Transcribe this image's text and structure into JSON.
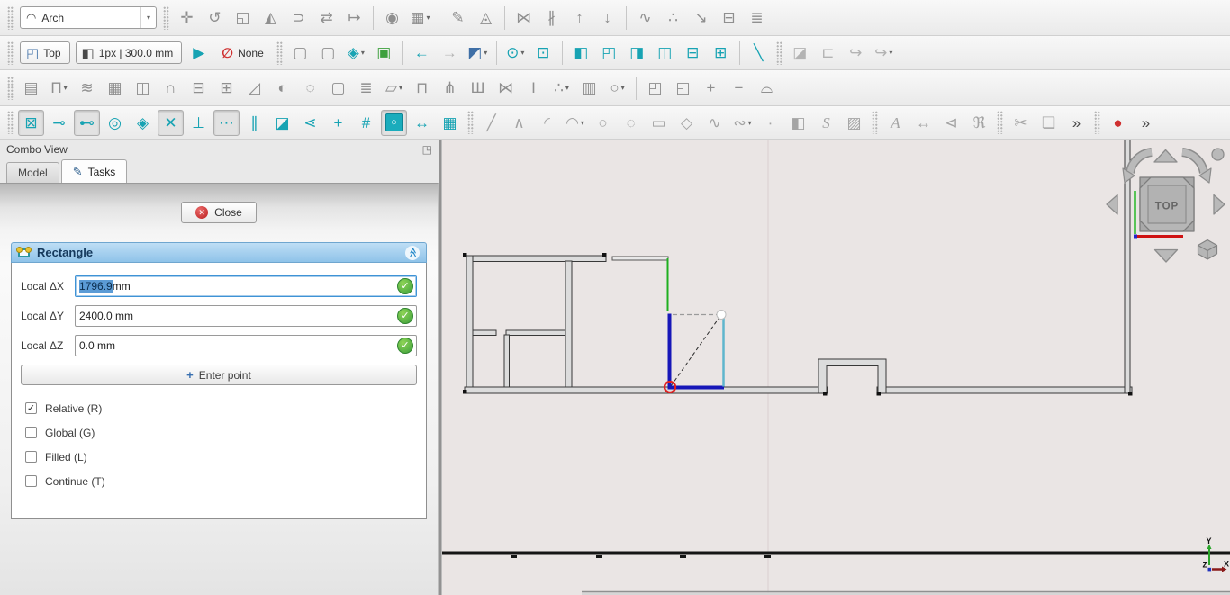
{
  "toolbars": {
    "row1": [
      {
        "t": "grip"
      },
      {
        "t": "select",
        "name": "workbench-selector",
        "icon": "arch-workbench-icon",
        "glyph": "◠",
        "c": "dark",
        "label": "Arch",
        "dd": true
      },
      {
        "t": "grip"
      },
      {
        "t": "btn",
        "name": "draft-move",
        "icon": "move-icon",
        "glyph": "✛",
        "c": "gray"
      },
      {
        "t": "btn",
        "name": "draft-rotate",
        "icon": "rotate-icon",
        "glyph": "↺",
        "c": "gray"
      },
      {
        "t": "btn",
        "name": "draft-scale",
        "icon": "scale-icon",
        "glyph": "◱",
        "c": "gray"
      },
      {
        "t": "btn",
        "name": "draft-mirror",
        "icon": "mirror-icon",
        "glyph": "◭",
        "c": "gray"
      },
      {
        "t": "btn",
        "name": "draft-offset",
        "icon": "offset-icon",
        "glyph": "⊃",
        "c": "gray"
      },
      {
        "t": "btn",
        "name": "draft-trimex",
        "icon": "trimex-icon",
        "glyph": "⇄",
        "c": "gray"
      },
      {
        "t": "btn",
        "name": "draft-stretch",
        "icon": "stretch-icon",
        "glyph": "↦",
        "c": "gray"
      },
      {
        "t": "sep"
      },
      {
        "t": "btn",
        "name": "draft-clone",
        "icon": "clone-icon",
        "glyph": "◉",
        "c": "gray"
      },
      {
        "t": "btn",
        "name": "draft-array-tools",
        "icon": "array-icon",
        "glyph": "▦",
        "c": "gray",
        "dd": true
      },
      {
        "t": "sep"
      },
      {
        "t": "btn",
        "name": "draft-edit",
        "icon": "edit-pencil-icon",
        "glyph": "✎",
        "c": "gray"
      },
      {
        "t": "btn",
        "name": "draft-highlight-subelements",
        "icon": "subelement-icon",
        "glyph": "◬",
        "c": "gray"
      },
      {
        "t": "sep"
      },
      {
        "t": "btn",
        "name": "draft-join",
        "icon": "join-icon",
        "glyph": "⋈",
        "c": "gray"
      },
      {
        "t": "btn",
        "name": "draft-split",
        "icon": "split-icon",
        "glyph": "∦",
        "c": "gray"
      },
      {
        "t": "btn",
        "name": "draft-upgrade",
        "icon": "upgrade-arrow-icon",
        "glyph": "↑",
        "c": "gray"
      },
      {
        "t": "btn",
        "name": "draft-downgrade",
        "icon": "downgrade-arrow-icon",
        "glyph": "↓",
        "c": "gray"
      },
      {
        "t": "sep"
      },
      {
        "t": "btn",
        "name": "draft-wire-to-bspline",
        "icon": "wire-bspline-icon",
        "glyph": "∿",
        "c": "gray"
      },
      {
        "t": "btn",
        "name": "draft-add-point",
        "icon": "add-point-icon",
        "glyph": "∴",
        "c": "gray"
      },
      {
        "t": "btn",
        "name": "draft-to-sketch",
        "icon": "draft-sketch-icon",
        "glyph": "↘",
        "c": "gray"
      },
      {
        "t": "btn",
        "name": "draft-shape-2d-view",
        "icon": "shape-2d-icon",
        "glyph": "⊟",
        "c": "gray"
      },
      {
        "t": "btn",
        "name": "draft-layer",
        "icon": "layers-icon",
        "glyph": "≣",
        "c": "gray"
      }
    ],
    "row2": [
      {
        "t": "grip"
      },
      {
        "t": "labelbtn",
        "name": "view-current-button",
        "icon": "view-cube-icon",
        "glyph": "◰",
        "c": "blue",
        "label": "Top"
      },
      {
        "t": "labelbtn",
        "name": "line-style-button",
        "icon": "line-style-icon",
        "glyph": "◧",
        "c": "dark",
        "label": "1px | 300.0 mm"
      },
      {
        "t": "btn",
        "name": "apply-current-style",
        "icon": "apply-style-arrow-icon",
        "glyph": "▶",
        "c": "teal"
      },
      {
        "t": "flat",
        "name": "autogroup-button",
        "icon": "no-autogroup-icon",
        "glyph": "∅",
        "c": "red",
        "label": "None"
      },
      {
        "t": "grip"
      },
      {
        "t": "btn",
        "name": "box-selection",
        "icon": "box-select-icon",
        "glyph": "▢",
        "c": "gray"
      },
      {
        "t": "btn",
        "name": "box-element-selection",
        "icon": "box-element-select-icon",
        "glyph": "▢",
        "c": "gray"
      },
      {
        "t": "btn",
        "name": "toggle-construction-mode",
        "icon": "construction-mode-icon",
        "glyph": "◈",
        "c": "teal",
        "dd": true
      },
      {
        "t": "btn",
        "name": "select-visible-object",
        "icon": "select-view-cube-icon",
        "glyph": "▣",
        "c": "green"
      },
      {
        "t": "sep"
      },
      {
        "t": "btn",
        "name": "nav-back",
        "icon": "back-arrow-icon",
        "glyph": "←",
        "c": "teal"
      },
      {
        "t": "btn",
        "name": "nav-forward",
        "icon": "forward-arrow-icon",
        "glyph": "→",
        "c": "silver"
      },
      {
        "t": "btn",
        "name": "view-axonometric",
        "icon": "axonometric-cube-icon",
        "glyph": "◩",
        "c": "blue",
        "dd": true
      },
      {
        "t": "sep"
      },
      {
        "t": "btn",
        "name": "zoom-tools",
        "icon": "magnifier-icon",
        "glyph": "⊙",
        "c": "teal",
        "dd": true
      },
      {
        "t": "btn",
        "name": "view-fit-all",
        "icon": "fit-all-cube-icon",
        "glyph": "⊡",
        "c": "teal"
      },
      {
        "t": "sep"
      },
      {
        "t": "btn",
        "name": "view-front",
        "icon": "front-view-cube-icon",
        "glyph": "◧",
        "c": "teal"
      },
      {
        "t": "btn",
        "name": "view-top",
        "icon": "top-view-cube-icon",
        "glyph": "◰",
        "c": "teal"
      },
      {
        "t": "btn",
        "name": "view-right",
        "icon": "right-view-cube-icon",
        "glyph": "◨",
        "c": "teal"
      },
      {
        "t": "btn",
        "name": "view-rear",
        "icon": "rear-view-cube-icon",
        "glyph": "◫",
        "c": "teal"
      },
      {
        "t": "btn",
        "name": "view-bottom",
        "icon": "bottom-view-cube-icon",
        "glyph": "⊟",
        "c": "teal"
      },
      {
        "t": "btn",
        "name": "view-left",
        "icon": "left-view-cube-icon",
        "glyph": "⊞",
        "c": "teal"
      },
      {
        "t": "sep"
      },
      {
        "t": "btn",
        "name": "measure-distance",
        "icon": "ruler-icon",
        "glyph": "╲",
        "c": "teal"
      },
      {
        "t": "grip"
      },
      {
        "t": "btn",
        "name": "part-simple-copy",
        "icon": "part-solid-icon",
        "glyph": "◪",
        "c": "silver"
      },
      {
        "t": "btn",
        "name": "std-open",
        "icon": "folder-icon",
        "glyph": "⊏",
        "c": "silver"
      },
      {
        "t": "btn",
        "name": "std-export",
        "icon": "export-icon",
        "glyph": "↪",
        "c": "silver"
      },
      {
        "t": "btn",
        "name": "std-export-more",
        "icon": "export-more-icon",
        "glyph": "↪",
        "c": "silver",
        "dd": true
      }
    ],
    "row3": [
      {
        "t": "grip"
      },
      {
        "t": "btn",
        "name": "arch-wall",
        "icon": "wall-icon",
        "glyph": "▤",
        "c": "gray"
      },
      {
        "t": "btn",
        "name": "arch-structure",
        "icon": "structure-icon",
        "glyph": "Π",
        "c": "gray",
        "dd": true
      },
      {
        "t": "btn",
        "name": "arch-rebar",
        "icon": "rebar-icon",
        "glyph": "≋",
        "c": "gray"
      },
      {
        "t": "btn",
        "name": "arch-curtain-wall",
        "icon": "curtain-wall-icon",
        "glyph": "▦",
        "c": "gray"
      },
      {
        "t": "btn",
        "name": "arch-building-part",
        "icon": "building-part-icon",
        "glyph": "◫",
        "c": "gray"
      },
      {
        "t": "btn",
        "name": "arch-project",
        "icon": "dome-icon",
        "glyph": "∩",
        "c": "gray"
      },
      {
        "t": "btn",
        "name": "arch-reference",
        "icon": "reference-icon",
        "glyph": "⊟",
        "c": "gray"
      },
      {
        "t": "btn",
        "name": "arch-window",
        "icon": "window-icon",
        "glyph": "⊞",
        "c": "gray"
      },
      {
        "t": "btn",
        "name": "arch-roof",
        "icon": "roof-icon",
        "glyph": "◿",
        "c": "gray"
      },
      {
        "t": "btn",
        "name": "arch-axis",
        "icon": "axis-icon",
        "glyph": "◐",
        "c": "gray"
      },
      {
        "t": "btn",
        "name": "arch-section-plane",
        "icon": "section-plane-icon",
        "glyph": "◌",
        "c": "gray"
      },
      {
        "t": "btn",
        "name": "arch-space",
        "icon": "space-icon",
        "glyph": "▢",
        "c": "gray"
      },
      {
        "t": "btn",
        "name": "arch-stairs",
        "icon": "stairs-icon",
        "glyph": "≣",
        "c": "gray"
      },
      {
        "t": "btn",
        "name": "arch-panel",
        "icon": "panel-icon",
        "glyph": "▱",
        "c": "gray",
        "dd": true
      },
      {
        "t": "btn",
        "name": "arch-equipment",
        "icon": "equipment-icon",
        "glyph": "⊓",
        "c": "gray"
      },
      {
        "t": "btn",
        "name": "arch-frame",
        "icon": "frame-icon",
        "glyph": "⋔",
        "c": "gray"
      },
      {
        "t": "btn",
        "name": "arch-fence",
        "icon": "fence-icon",
        "glyph": "Ш",
        "c": "gray"
      },
      {
        "t": "btn",
        "name": "arch-truss",
        "icon": "truss-icon",
        "glyph": "⋈",
        "c": "gray"
      },
      {
        "t": "btn",
        "name": "arch-profile",
        "icon": "profile-ibeam-icon",
        "glyph": "I",
        "c": "gray"
      },
      {
        "t": "btn",
        "name": "arch-material",
        "icon": "material-balls-icon",
        "glyph": "∴",
        "c": "gray",
        "dd": true
      },
      {
        "t": "btn",
        "name": "arch-schedule",
        "icon": "schedule-table-icon",
        "glyph": "▥",
        "c": "gray"
      },
      {
        "t": "btn",
        "name": "arch-pipe",
        "icon": "pipe-icon",
        "glyph": "○",
        "c": "gray",
        "dd": true
      },
      {
        "t": "sep"
      },
      {
        "t": "btn",
        "name": "arch-cut-plane",
        "icon": "cut-plane-icon",
        "glyph": "◰",
        "c": "gray"
      },
      {
        "t": "btn",
        "name": "arch-cut-line",
        "icon": "cut-line-icon",
        "glyph": "◱",
        "c": "gray"
      },
      {
        "t": "btn",
        "name": "arch-add-component",
        "icon": "plus-icon",
        "glyph": "+",
        "c": "gray"
      },
      {
        "t": "btn",
        "name": "arch-remove-component",
        "icon": "minus-icon",
        "glyph": "−",
        "c": "gray"
      },
      {
        "t": "btn",
        "name": "arch-survey",
        "icon": "helmet-icon",
        "glyph": "⌓",
        "c": "gray"
      }
    ],
    "row4": [
      {
        "t": "grip"
      },
      {
        "t": "btn",
        "name": "snap-lock",
        "icon": "padlock-icon",
        "glyph": "⊠",
        "c": "teal",
        "pressed": true
      },
      {
        "t": "btn",
        "name": "snap-endpoint",
        "icon": "endpoint-icon",
        "glyph": "⊸",
        "c": "teal"
      },
      {
        "t": "btn",
        "name": "snap-midpoint",
        "icon": "midpoint-icon",
        "glyph": "⊷",
        "c": "teal",
        "pressed": true
      },
      {
        "t": "btn",
        "name": "snap-center",
        "icon": "center-icon",
        "glyph": "◎",
        "c": "teal"
      },
      {
        "t": "btn",
        "name": "snap-angle",
        "icon": "angle-icon",
        "glyph": "◈",
        "c": "teal"
      },
      {
        "t": "btn",
        "name": "snap-intersection",
        "icon": "intersection-icon",
        "glyph": "✕",
        "c": "teal",
        "pressed": true
      },
      {
        "t": "btn",
        "name": "snap-perpendicular",
        "icon": "perpendicular-icon",
        "glyph": "⊥",
        "c": "teal"
      },
      {
        "t": "btn",
        "name": "snap-extension",
        "icon": "extension-dots-icon",
        "glyph": "⋯",
        "c": "teal",
        "pressed": true
      },
      {
        "t": "btn",
        "name": "snap-parallel",
        "icon": "parallel-icon",
        "glyph": "∥",
        "c": "teal"
      },
      {
        "t": "btn",
        "name": "snap-ortho",
        "icon": "ortho-icon",
        "glyph": "◪",
        "c": "teal"
      },
      {
        "t": "btn",
        "name": "snap-near",
        "icon": "near-icon",
        "glyph": "⋖",
        "c": "teal"
      },
      {
        "t": "btn",
        "name": "snap-special",
        "icon": "special-plus-icon",
        "glyph": "+",
        "c": "teal"
      },
      {
        "t": "btn",
        "name": "snap-grid",
        "icon": "grid-hash-icon",
        "glyph": "#",
        "c": "teal"
      },
      {
        "t": "btn",
        "name": "snap-working-plane",
        "icon": "working-plane-icon",
        "glyph": "○",
        "c": "teal",
        "pressed": true,
        "wp": true
      },
      {
        "t": "btn",
        "name": "snap-dimensions",
        "icon": "dimensions-icon",
        "glyph": "↔",
        "c": "teal"
      },
      {
        "t": "btn",
        "name": "toggle-grid",
        "icon": "grid-toggle-icon",
        "glyph": "▦",
        "c": "teal"
      },
      {
        "t": "grip"
      },
      {
        "t": "btn",
        "name": "draft-line",
        "icon": "line-icon",
        "glyph": "╱",
        "c": "gray2"
      },
      {
        "t": "btn",
        "name": "draft-polyline",
        "icon": "polyline-icon",
        "glyph": "∧",
        "c": "gray2"
      },
      {
        "t": "btn",
        "name": "draft-fillet",
        "icon": "fillet-icon",
        "glyph": "◜",
        "c": "gray2"
      },
      {
        "t": "btn",
        "name": "draft-arc",
        "icon": "arc-icon",
        "glyph": "◠",
        "c": "gray2",
        "dd": true
      },
      {
        "t": "btn",
        "name": "draft-circle",
        "icon": "circle-icon",
        "glyph": "○",
        "c": "gray2"
      },
      {
        "t": "btn",
        "name": "draft-ellipse",
        "icon": "ellipse-icon",
        "glyph": "◌",
        "c": "gray2"
      },
      {
        "t": "btn",
        "name": "draft-rectangle",
        "icon": "rectangle-icon",
        "glyph": "▭",
        "c": "gray2"
      },
      {
        "t": "btn",
        "name": "draft-polygon",
        "icon": "polygon-icon",
        "glyph": "◇",
        "c": "gray2"
      },
      {
        "t": "btn",
        "name": "draft-bspline",
        "icon": "bspline-icon",
        "glyph": "∿",
        "c": "gray2"
      },
      {
        "t": "btn",
        "name": "draft-bezier",
        "icon": "bezier-icon",
        "glyph": "∾",
        "c": "gray2",
        "dd": true
      },
      {
        "t": "btn",
        "name": "draft-point",
        "icon": "point-icon",
        "glyph": "∙",
        "c": "gray2"
      },
      {
        "t": "btn",
        "name": "draft-facebinder",
        "icon": "facebinder-icon",
        "glyph": "◧",
        "c": "gray2"
      },
      {
        "t": "btn",
        "name": "draft-shapestring",
        "icon": "shapestring-icon",
        "glyph": "S",
        "c": "gray2",
        "it": true
      },
      {
        "t": "btn",
        "name": "draft-hatch",
        "icon": "hatch-icon",
        "glyph": "▨",
        "c": "gray2"
      },
      {
        "t": "grip"
      },
      {
        "t": "btn",
        "name": "draft-text",
        "icon": "text-icon",
        "glyph": "A",
        "c": "gray2",
        "it": true
      },
      {
        "t": "btn",
        "name": "draft-dimension",
        "icon": "dimension-icon",
        "glyph": "↔",
        "c": "gray2"
      },
      {
        "t": "btn",
        "name": "draft-label",
        "icon": "label-icon",
        "glyph": "⊲",
        "c": "gray2"
      },
      {
        "t": "btn",
        "name": "annotation-styles",
        "icon": "annotation-style-icon",
        "glyph": "ℜ",
        "c": "gray2"
      },
      {
        "t": "grip"
      },
      {
        "t": "btn",
        "name": "edit-cut",
        "icon": "scissors-icon",
        "glyph": "✂",
        "c": "gray2"
      },
      {
        "t": "btn",
        "name": "edit-copy",
        "icon": "copy-icon",
        "glyph": "❏",
        "c": "gray2"
      },
      {
        "t": "btn",
        "name": "toolbar-overflow-1",
        "icon": "overflow-chevrons-icon",
        "glyph": "»",
        "c": "dark"
      },
      {
        "t": "grip"
      },
      {
        "t": "btn",
        "name": "macro-record",
        "icon": "record-dot-icon",
        "glyph": "●",
        "c": "red"
      },
      {
        "t": "btn",
        "name": "toolbar-overflow-2",
        "icon": "overflow-chevrons-icon",
        "glyph": "»",
        "c": "dark"
      }
    ]
  },
  "combo_view": {
    "title": "Combo View",
    "float_icon": "◳",
    "tabs": {
      "model": "Model",
      "tasks": "Tasks",
      "tasks_icon": "✎"
    },
    "close_button": "Close",
    "close_icon": "✕",
    "task": {
      "section_title": "Rectangle",
      "collapse_icon": "≪",
      "check_icon": "✓",
      "fields": [
        {
          "label": "Local ΔX",
          "value_selected": "1796.9",
          "value_rest": " mm"
        },
        {
          "label": "Local ΔY",
          "value": "2400.0 mm"
        },
        {
          "label": "Local ΔZ",
          "value": "0.0 mm"
        }
      ],
      "enter_point_button": "Enter point",
      "enter_point_icon": "+",
      "checkboxes": [
        {
          "label": "Relative (R)",
          "checked": true
        },
        {
          "label": "Global (G)",
          "checked": false
        },
        {
          "label": "Filled (L)",
          "checked": false
        },
        {
          "label": "Continue (T)",
          "checked": false
        }
      ]
    }
  },
  "viewport": {
    "navigation_cube": {
      "face_label": "TOP"
    },
    "axes": {
      "x": "X",
      "y": "Y",
      "z": "Z"
    }
  },
  "colors": {
    "accent_teal": "#17a3b3",
    "selection_blue": "#5b9bd5",
    "valid_green": "#3c9f3c",
    "snap_red": "#e02020",
    "draft_blue": "#1717b8",
    "section_header_blue": "#8fc3e9",
    "viewport_bg": "#eae5e4"
  }
}
